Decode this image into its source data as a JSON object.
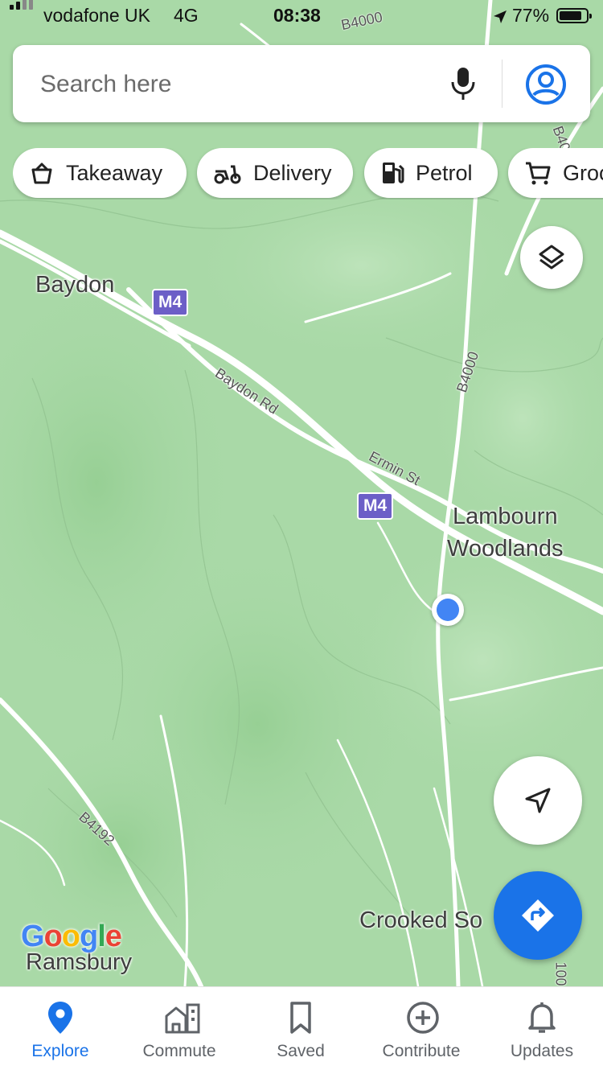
{
  "status_bar": {
    "carrier": "vodafone UK",
    "network": "4G",
    "time": "08:38",
    "battery": "77%"
  },
  "search": {
    "placeholder": "Search here"
  },
  "chips": [
    {
      "label": "Takeaway",
      "icon": "takeaway-icon"
    },
    {
      "label": "Delivery",
      "icon": "delivery-scooter-icon"
    },
    {
      "label": "Petrol",
      "icon": "petrol-pump-icon"
    },
    {
      "label": "Groc",
      "icon": "shopping-cart-icon"
    }
  ],
  "map": {
    "places": {
      "baydon": "Baydon",
      "lambourn_1": "Lambourn",
      "lambourn_2": "Woodlands",
      "crooked": "Crooked So",
      "ramsbury": "Ramsbury"
    },
    "roads": {
      "b4000_top": "B4000",
      "b4000_mid": "B4000",
      "baydon_rd": "Baydon Rd",
      "ermin_st": "Ermin St",
      "b4192": "B4192",
      "b40_right": "B40",
      "b400_bottom": "100"
    },
    "motorway_shields": {
      "m4_left": "M4",
      "m4_center": "M4"
    },
    "logo": "Google",
    "colors": {
      "land": "#a9d9a7",
      "road": "#ffffff",
      "motorway_shield": "#6c5fc7",
      "location_dot": "#4285f4",
      "accent": "#1a73e8"
    }
  },
  "nav": [
    {
      "label": "Explore",
      "icon": "explore-pin-icon",
      "active": true
    },
    {
      "label": "Commute",
      "icon": "commute-icon",
      "active": false
    },
    {
      "label": "Saved",
      "icon": "bookmark-icon",
      "active": false
    },
    {
      "label": "Contribute",
      "icon": "add-circle-icon",
      "active": false
    },
    {
      "label": "Updates",
      "icon": "bell-icon",
      "active": false
    }
  ]
}
